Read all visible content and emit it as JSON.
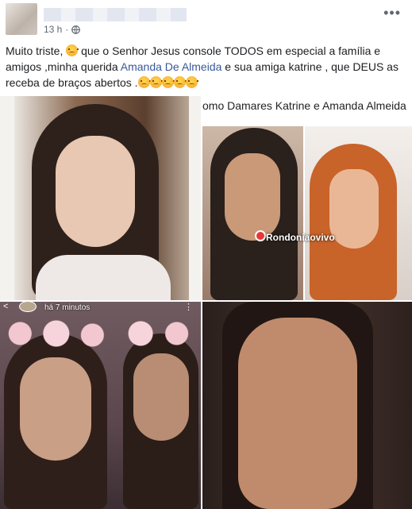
{
  "post": {
    "timestamp": "13 h",
    "separator": "·",
    "audience_icon": "globe-icon",
    "menu_icon": "more-options-icon",
    "menu_label": "•••",
    "text": {
      "part1": "Muito triste, ",
      "part2": " que o Senhor Jesus console TODOS em especial a família e amigos ,minha querida ",
      "mention": "Amanda De Almeida",
      "part3": " e sua amiga katrine , que DEUS as receba de braços abertos ."
    },
    "emoji_name": "pensive-face-emoji"
  },
  "photos": {
    "photo2_caption": "omo Damares Katrine e Amanda Almeida",
    "photo2_logo": "Rondoniaovivo",
    "photo3_back": "<",
    "photo3_time": "há 7 minutos",
    "photo3_dots": "⋮"
  },
  "colors": {
    "link": "#385898",
    "meta": "#606770"
  }
}
